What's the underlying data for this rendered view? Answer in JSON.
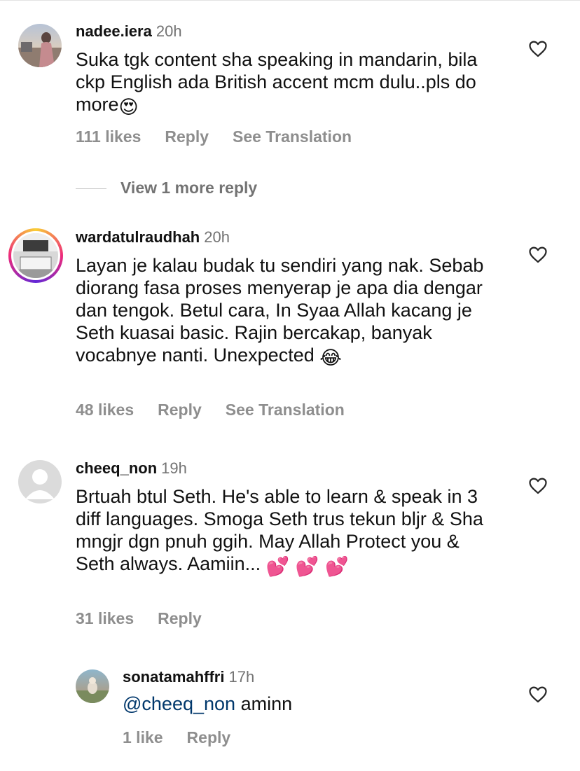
{
  "comments": [
    {
      "username": "nadee.iera",
      "time": "20h",
      "text": "Suka tgk content sha speaking in mandarin, bila ckp English ada British accent mcm dulu..pls do more",
      "emoji": "😍",
      "likes": "111 likes",
      "reply": "Reply",
      "translation": "See Translation",
      "avatar_icon": "profile-photo"
    },
    {
      "username": "wardatulraudhah",
      "time": "20h",
      "text": "Layan je kalau budak tu sendiri yang nak. Sebab diorang fasa proses menyerap je apa dia dengar dan tengok. Betul cara, In Syaa Allah kacang je Seth kuasai basic. Rajin bercakap, banyak vocabnye nanti. Unexpected",
      "emoji": "😂",
      "likes": "48 likes",
      "reply": "Reply",
      "translation": "See Translation",
      "avatar_icon": "story-ring-profile-photo"
    },
    {
      "username": "cheeq_non",
      "time": "19h",
      "text": "Brtuah btul Seth. He's able to learn & speak in 3 diff languages. Smoga Seth trus tekun bljr & Sha mngjr dgn pnuh ggih. May Allah Protect you & Seth always. Aamiin...",
      "emoji": "💕 💕 💕",
      "likes": "31 likes",
      "reply": "Reply",
      "avatar_icon": "default-avatar"
    }
  ],
  "view_more_replies": "View 1 more reply",
  "reply_comment": {
    "username": "sonatamahffri",
    "time": "17h",
    "mention": "@cheeq_non",
    "text": "aminn",
    "likes": "1 like",
    "reply": "Reply",
    "avatar_icon": "profile-photo"
  },
  "colors": {
    "text": "#111111",
    "muted": "#8e8e8e",
    "mention": "#00376b",
    "story_ring_start": "#f9ce34",
    "story_ring_end": "#ee2a7b"
  }
}
